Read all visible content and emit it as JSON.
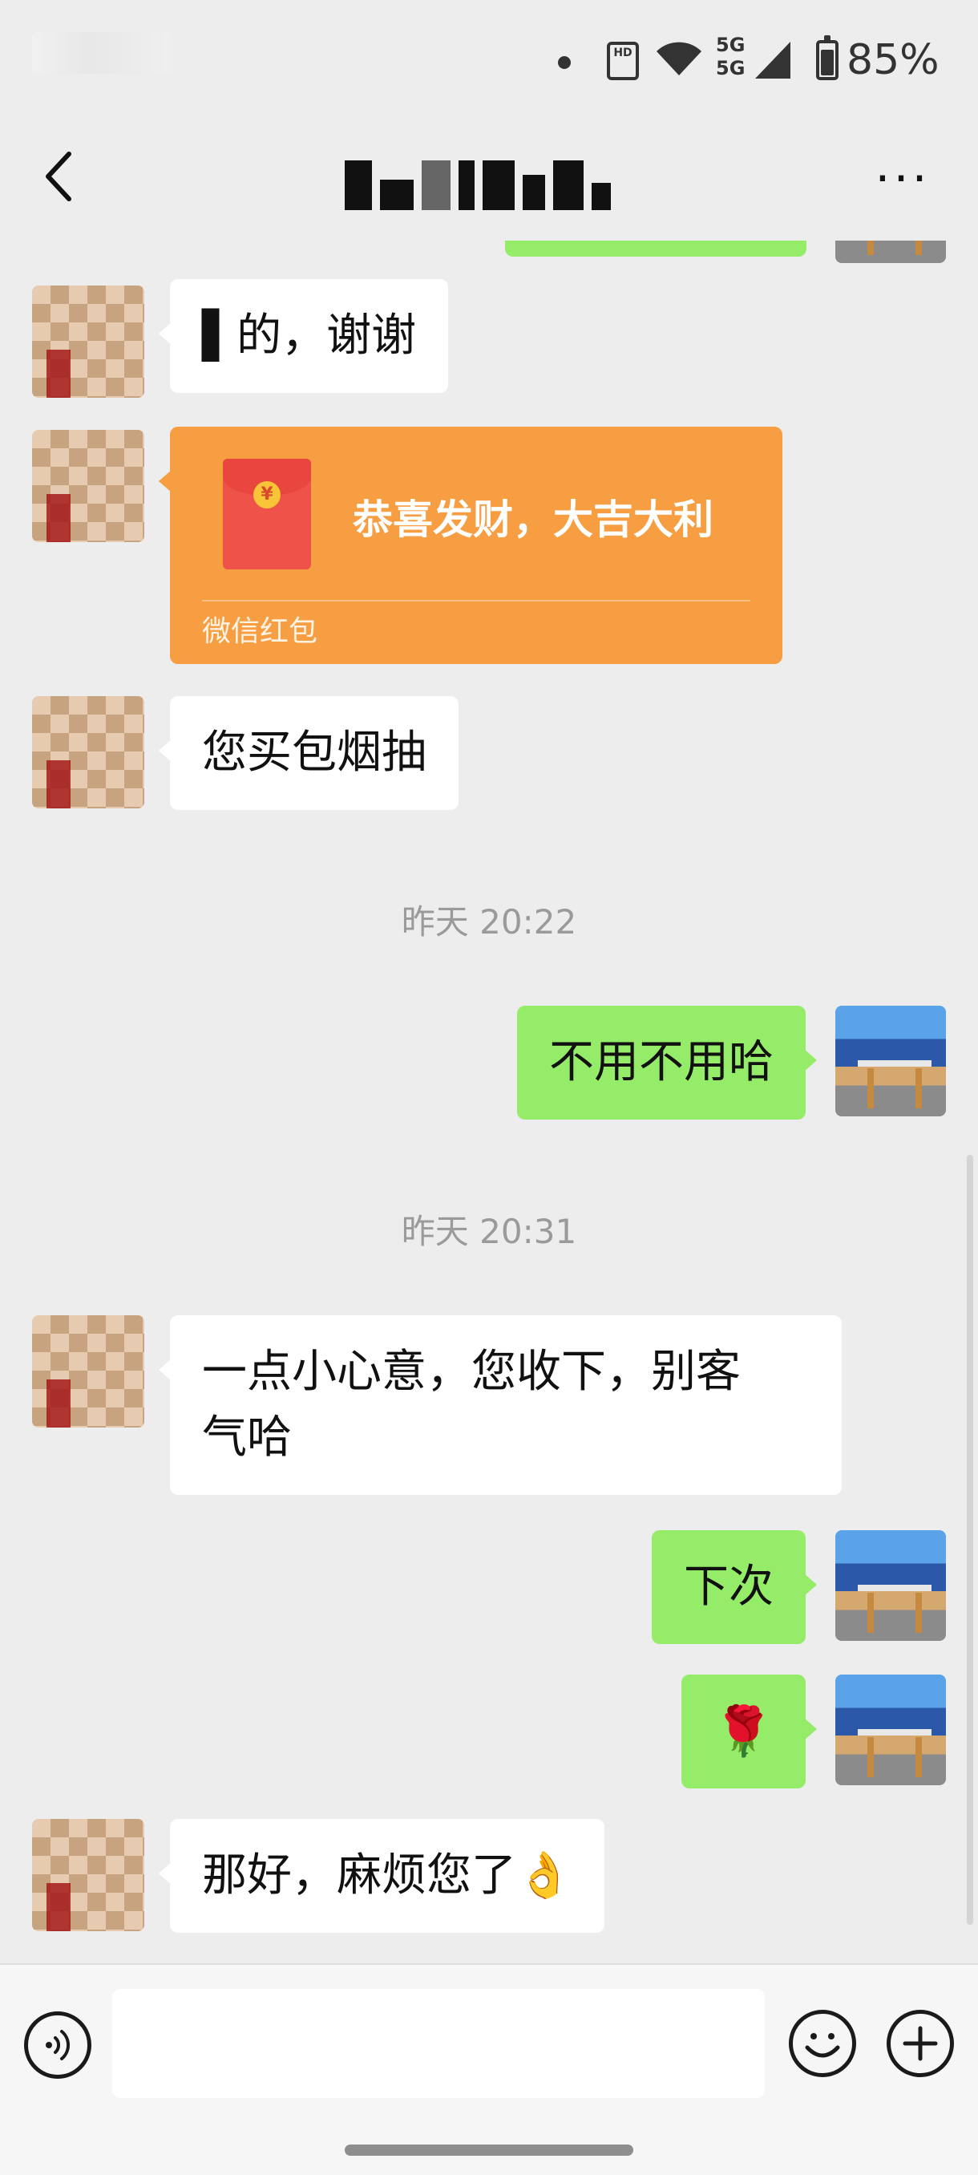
{
  "status_bar": {
    "five_g_top": "5G",
    "five_g_bottom": "5G",
    "battery_percent": "85%",
    "battery_level": 0.85
  },
  "header": {
    "title": "",
    "back_icon": "chevron-left-icon",
    "more_icon": "more-horizontal-icon",
    "more_label": "···"
  },
  "messages": [
    {
      "side": "left",
      "text": "▌的，谢谢"
    },
    {
      "side": "left",
      "type": "red_packet",
      "title": "恭喜发财，大吉大利",
      "label": "微信红包",
      "coin": "¥"
    },
    {
      "side": "left",
      "text": "您买包烟抽"
    },
    {
      "type": "timestamp",
      "text": "昨天 20:22"
    },
    {
      "side": "right",
      "text": "不用不用哈"
    },
    {
      "type": "timestamp",
      "text": "昨天 20:31"
    },
    {
      "side": "left",
      "text": "一点小心意，您收下，别客\n气哈"
    },
    {
      "side": "right",
      "text": "下次"
    },
    {
      "side": "right",
      "text": "🌹"
    },
    {
      "side": "left",
      "text": "那好，麻烦您了👌"
    }
  ],
  "input_bar": {
    "placeholder": "",
    "voice_icon": "voice-icon",
    "emoji_icon": "emoji-icon",
    "plus_icon": "plus-icon"
  },
  "colors": {
    "background": "#ededed",
    "bubble_self": "#95ec69",
    "bubble_other": "#ffffff",
    "red_packet": "#f79e42"
  }
}
